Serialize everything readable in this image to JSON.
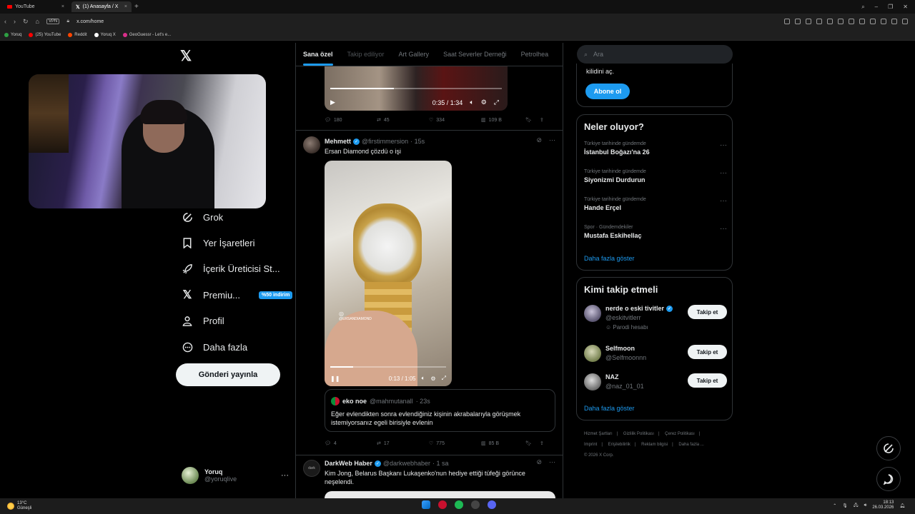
{
  "browser": {
    "tabs": [
      {
        "label": "YouTube",
        "active": false
      },
      {
        "label": "(1) Anasayfa / X",
        "active": true
      }
    ],
    "vpn_label": "VPN",
    "url": "x.com/home",
    "bookmarks": [
      {
        "label": "Yoruq",
        "color": "#2ea043"
      },
      {
        "label": "(25) YouTube",
        "color": "#ff0000"
      },
      {
        "label": "Reddit",
        "color": "#ff4500"
      },
      {
        "label": "Yoruq X",
        "color": "#ffffff"
      },
      {
        "label": "GeoGuessr - Let's e...",
        "color": "#d92f8a"
      }
    ]
  },
  "left_nav": {
    "items": [
      {
        "label": "Grok",
        "icon": "grok-icon"
      },
      {
        "label": "Yer İşaretleri",
        "icon": "bookmark-icon"
      },
      {
        "label": "İçerik Üreticisi St...",
        "icon": "rocket-icon"
      },
      {
        "label": "Premiu...",
        "icon": "x-logo-icon",
        "badge": "%50 indirim"
      },
      {
        "label": "Profil",
        "icon": "person-icon"
      },
      {
        "label": "Daha fazla",
        "icon": "more-circle-icon"
      }
    ],
    "post_button": "Gönderi yayınla",
    "account": {
      "name": "Yoruq",
      "handle": "@yoruqlive"
    }
  },
  "feed": {
    "tabs": [
      {
        "label": "Sana özel",
        "selected": true
      },
      {
        "label": "Takip ediliyor",
        "selected": false
      },
      {
        "label": "Art Gallery",
        "selected": false
      },
      {
        "label": "Saat Severler Derneği",
        "selected": false
      },
      {
        "label": "Petrolhea",
        "selected": false
      }
    ],
    "top_video": {
      "time": "0:35 / 1:34",
      "progress": 0.37
    },
    "top_actions": {
      "replies": "180",
      "reposts": "45",
      "likes": "334",
      "views": "109 B"
    },
    "tweet1": {
      "name": "Mehmett",
      "handle": "@firstimmersion",
      "time": "· 15s",
      "text": "Ersan Diamond çözdü o işi",
      "video_time": "0:13 / 1:05",
      "video_progress": 0.2,
      "watermark": "@ERSANDIAMOND",
      "quote": {
        "name": "eko noe",
        "handle": "@mahmutanall",
        "time": "· 23s",
        "text": "Eğer evlendikten sonra evlendiğiniz kişinin akrabalarıyla görüşmek istemiyorsanız egeli birisiyle evlenin"
      },
      "actions": {
        "replies": "4",
        "reposts": "17",
        "likes": "775",
        "views": "85 B"
      }
    },
    "tweet2": {
      "name": "DarkWeb Haber",
      "handle": "@darkwebhaber",
      "time": "· 1 sa",
      "avatar_text": "dark",
      "text": "Kim Jong, Belarus Başkanı Lukaşenko'nun hediye ettiği tüfeği görünce neşelendi."
    }
  },
  "right": {
    "search_placeholder": "Ara",
    "premium": {
      "text": "kilidini aç.",
      "button": "Abone ol"
    },
    "trends": {
      "title": "Neler oluyor?",
      "items": [
        {
          "context": "Türkiye tarihinde gündemde",
          "topic": "İstanbul Boğazı'na 26"
        },
        {
          "context": "Türkiye tarihinde gündemde",
          "topic": "Siyonizmi Durdurun"
        },
        {
          "context": "Türkiye tarihinde gündemde",
          "topic": "Hande Erçel"
        },
        {
          "context": "Spor · Gündemdekiler",
          "topic": "Mustafa Eskihellaç"
        }
      ],
      "show_more": "Daha fazla göster"
    },
    "who_to_follow": {
      "title": "Kimi takip etmeli",
      "items": [
        {
          "name": "nerde o eski tivitler",
          "handle": "@eskitvitlerr",
          "extra": "Parodi hesabı",
          "verified": true,
          "button": "Takip et"
        },
        {
          "name": "Selfmoon",
          "handle": "@Selfmoonnn",
          "extra": "",
          "verified": false,
          "button": "Takip et"
        },
        {
          "name": "NAZ",
          "handle": "@naz_01_01",
          "extra": "",
          "verified": false,
          "button": "Takip et"
        }
      ],
      "show_more": "Daha fazla göster"
    },
    "footer": [
      "Hizmet Şartları",
      "Gizlilik Politikası",
      "Çerez Politikası",
      "Imprint",
      "Erişilebilirlik",
      "Reklam bilgisi",
      "Daha fazla ...",
      "© 2026 X Corp."
    ]
  },
  "taskbar": {
    "weather_temp": "13°C",
    "weather_desc": "Güneşli",
    "time": "18:13",
    "date": "26.03.2026"
  }
}
